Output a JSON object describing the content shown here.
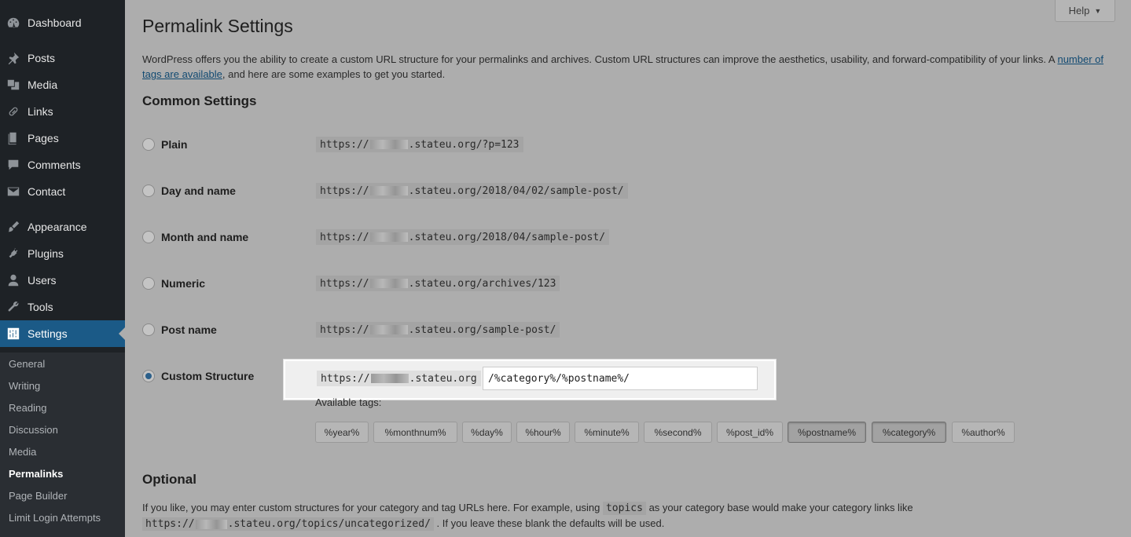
{
  "sidebar": {
    "items": [
      {
        "label": "Dashboard",
        "icon": "dashboard-icon"
      },
      {
        "label": "Posts",
        "icon": "pin-icon"
      },
      {
        "label": "Media",
        "icon": "media-icon"
      },
      {
        "label": "Links",
        "icon": "link-icon"
      },
      {
        "label": "Pages",
        "icon": "pages-icon"
      },
      {
        "label": "Comments",
        "icon": "comment-icon"
      },
      {
        "label": "Contact",
        "icon": "mail-icon"
      },
      {
        "label": "Appearance",
        "icon": "brush-icon"
      },
      {
        "label": "Plugins",
        "icon": "plug-icon"
      },
      {
        "label": "Users",
        "icon": "user-icon"
      },
      {
        "label": "Tools",
        "icon": "wrench-icon"
      },
      {
        "label": "Settings",
        "icon": "settings-icon"
      }
    ],
    "submenu": [
      "General",
      "Writing",
      "Reading",
      "Discussion",
      "Media",
      "Permalinks",
      "Page Builder",
      "Limit Login Attempts"
    ],
    "current_submenu": "Permalinks"
  },
  "help": {
    "label": "Help"
  },
  "page": {
    "title": "Permalink Settings",
    "intro_before_link": "WordPress offers you the ability to create a custom URL structure for your permalinks and archives. Custom URL structures can improve the aesthetics, usability, and forward-compatibility of your links. A ",
    "intro_link": "number of tags are available",
    "intro_after_link": ", and here are some examples to get you started."
  },
  "common": {
    "heading": "Common Settings",
    "options": [
      {
        "label": "Plain",
        "prefix": "https://",
        "suffix": ".stateu.org/?p=123",
        "checked": false
      },
      {
        "label": "Day and name",
        "prefix": "https://",
        "suffix": ".stateu.org/2018/04/02/sample-post/",
        "checked": false
      },
      {
        "label": "Month and name",
        "prefix": "https://",
        "suffix": ".stateu.org/2018/04/sample-post/",
        "checked": false
      },
      {
        "label": "Numeric",
        "prefix": "https://",
        "suffix": ".stateu.org/archives/123",
        "checked": false
      },
      {
        "label": "Post name",
        "prefix": "https://",
        "suffix": ".stateu.org/sample-post/",
        "checked": false
      },
      {
        "label": "Custom Structure",
        "checked": true
      }
    ],
    "custom": {
      "prefix_start": "https://",
      "prefix_end": ".stateu.org",
      "value": "/%category%/%postname%/"
    },
    "available_tags_label": "Available tags:",
    "tags": [
      "%year%",
      "%monthnum%",
      "%day%",
      "%hour%",
      "%minute%",
      "%second%",
      "%post_id%",
      "%postname%",
      "%category%",
      "%author%"
    ],
    "pressed_tags": [
      "%postname%",
      "%category%"
    ]
  },
  "optional": {
    "heading": "Optional",
    "text_before": "If you like, you may enter custom structures for your category and tag URLs here. For example, using ",
    "code": "topics",
    "text_middle": " as your category base would make your category links like",
    "url_prefix": "https://",
    "url_suffix": ".stateu.org/topics/uncategorized/",
    "text_after": " . If you leave these blank the defaults will be used."
  }
}
